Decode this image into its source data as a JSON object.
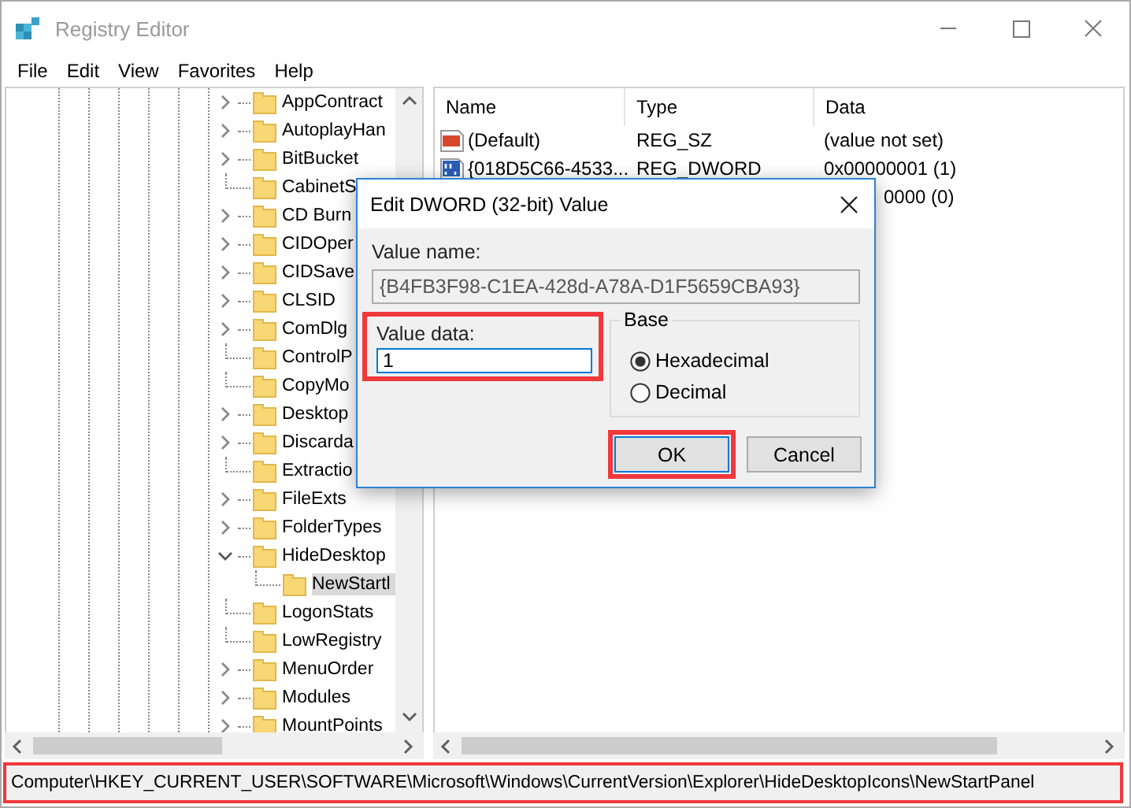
{
  "window": {
    "title": "Registry Editor"
  },
  "menu": [
    "File",
    "Edit",
    "View",
    "Favorites",
    "Help"
  ],
  "tree": {
    "items": [
      {
        "label": "AppContract",
        "kind": "branch",
        "expanded": false,
        "selected": false
      },
      {
        "label": "AutoplayHan",
        "kind": "branch",
        "expanded": false,
        "selected": false
      },
      {
        "label": "BitBucket",
        "kind": "branch",
        "expanded": false,
        "selected": false
      },
      {
        "label": "CabinetS",
        "kind": "leaf",
        "selected": false
      },
      {
        "label": "CD Burn",
        "kind": "branch",
        "expanded": false,
        "selected": false
      },
      {
        "label": "CIDOper",
        "kind": "branch",
        "expanded": false,
        "selected": false
      },
      {
        "label": "CIDSave",
        "kind": "branch",
        "expanded": false,
        "selected": false
      },
      {
        "label": "CLSID",
        "kind": "branch",
        "expanded": false,
        "selected": false
      },
      {
        "label": "ComDlg",
        "kind": "branch",
        "expanded": false,
        "selected": false
      },
      {
        "label": "ControlP",
        "kind": "leaf",
        "selected": false
      },
      {
        "label": "CopyMo",
        "kind": "leaf",
        "selected": false
      },
      {
        "label": "Desktop",
        "kind": "branch",
        "expanded": false,
        "selected": false
      },
      {
        "label": "Discarda",
        "kind": "branch",
        "expanded": false,
        "selected": false
      },
      {
        "label": "Extractio",
        "kind": "leaf",
        "selected": false
      },
      {
        "label": "FileExts",
        "kind": "branch",
        "expanded": false,
        "selected": false
      },
      {
        "label": "FolderTypes",
        "kind": "branch",
        "expanded": false,
        "selected": false
      },
      {
        "label": "HideDesktop",
        "kind": "branch",
        "expanded": true,
        "selected": false,
        "children": [
          {
            "label": "NewStartl",
            "kind": "leaf",
            "selected": true
          }
        ]
      },
      {
        "label": "LogonStats",
        "kind": "leaf",
        "selected": false
      },
      {
        "label": "LowRegistry",
        "kind": "leaf",
        "selected": false
      },
      {
        "label": "MenuOrder",
        "kind": "branch",
        "expanded": false,
        "selected": false
      },
      {
        "label": "Modules",
        "kind": "branch",
        "expanded": false,
        "selected": false
      },
      {
        "label": "MountPoints",
        "kind": "branch",
        "expanded": false,
        "selected": false
      }
    ]
  },
  "values": {
    "columns": [
      "Name",
      "Type",
      "Data"
    ],
    "rows": [
      {
        "kind": "string",
        "name": "(Default)",
        "type": "REG_SZ",
        "data": "(value not set)"
      },
      {
        "kind": "dword",
        "name": "{018D5C66-4533...",
        "type": "REG_DWORD",
        "data": "0x00000001 (1)"
      },
      {
        "kind": "covered",
        "data": "0000 (0)"
      }
    ]
  },
  "dialog": {
    "title": "Edit DWORD (32-bit) Value",
    "value_name_label": "Value name:",
    "value_name": "{B4FB3F98-C1EA-428d-A78A-D1F5659CBA93}",
    "value_data_label": "Value data:",
    "value_data": "1",
    "value_data_highlighted": true,
    "base_label": "Base",
    "options": [
      {
        "label": "Hexadecimal",
        "selected": true
      },
      {
        "label": "Decimal",
        "selected": false
      }
    ],
    "buttons": [
      {
        "label": "OK",
        "default": true,
        "highlighted": true
      },
      {
        "label": "Cancel",
        "default": false,
        "highlighted": false
      }
    ]
  },
  "status_bar": {
    "path": "Computer\\HKEY_CURRENT_USER\\SOFTWARE\\Microsoft\\Windows\\CurrentVersion\\Explorer\\HideDesktopIcons\\NewStartPanel",
    "highlighted": true
  }
}
